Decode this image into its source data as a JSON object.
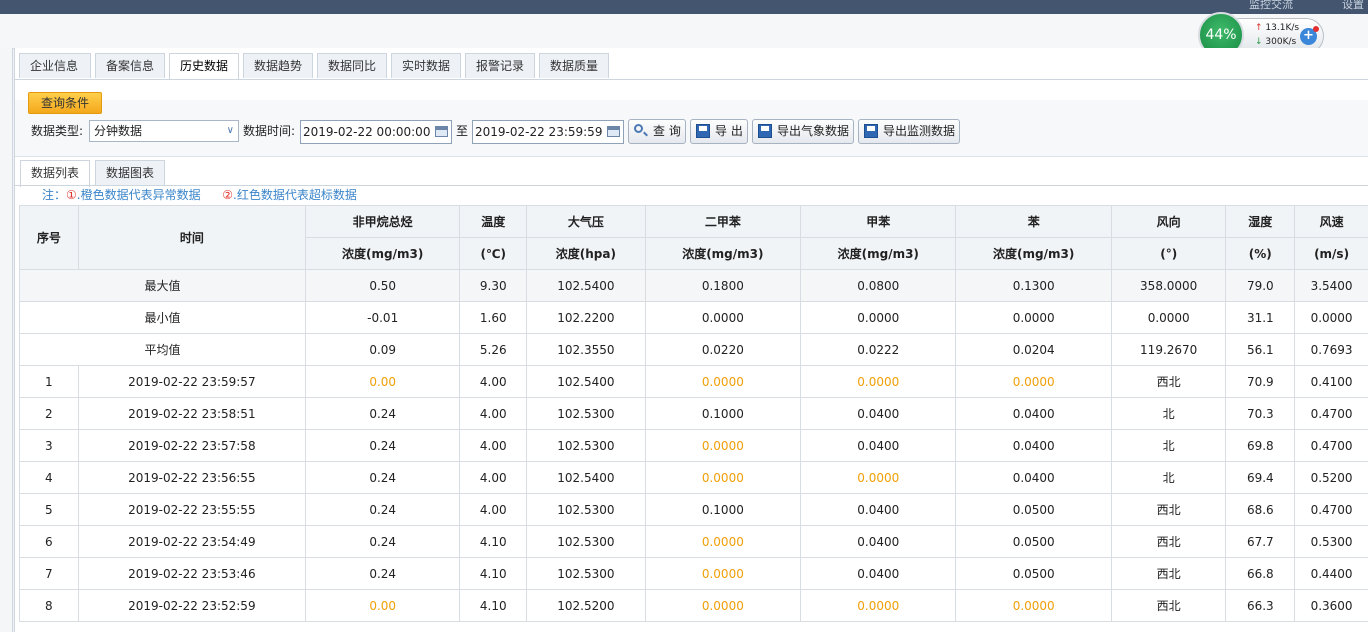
{
  "topbar": {
    "items": [
      "监控交流",
      "设置"
    ]
  },
  "tabs": [
    "企业信息",
    "备案信息",
    "历史数据",
    "数据趋势",
    "数据同比",
    "实时数据",
    "报警记录",
    "数据质量"
  ],
  "active_tab": 2,
  "query": {
    "header": "查询条件",
    "type_label": "数据类型:",
    "type_value": "分钟数据",
    "time_label": "数据时间:",
    "start": "2019-02-22 00:00:00",
    "to": "至",
    "end": "2019-02-22 23:59:59",
    "buttons": [
      "查 询",
      "导 出",
      "导出气象数据",
      "导出监测数据"
    ]
  },
  "subtabs": [
    "数据列表",
    "数据图表"
  ],
  "note": {
    "prefix": "注：",
    "n1": "①",
    "t1": ".橙色数据代表异常数据",
    "n2": "②",
    "t2": ".红色数据代表超标数据"
  },
  "table": {
    "col_seq": "序号",
    "col_time": "时间",
    "groups": [
      "非甲烷总烃",
      "温度",
      "大气压",
      "二甲苯",
      "甲苯",
      "苯",
      "风向",
      "湿度",
      "风速"
    ],
    "units": [
      "浓度(mg/m3)",
      "(℃)",
      "浓度(hpa)",
      "浓度(mg/m3)",
      "浓度(mg/m3)",
      "浓度(mg/m3)",
      "(°)",
      "(%)",
      "(m/s)"
    ],
    "stats": [
      {
        "label": "最大值",
        "v": [
          "0.50",
          "9.30",
          "102.5400",
          "0.1800",
          "0.0800",
          "0.1300",
          "358.0000",
          "79.0",
          "3.5400"
        ]
      },
      {
        "label": "最小值",
        "v": [
          "-0.01",
          "1.60",
          "102.2200",
          "0.0000",
          "0.0000",
          "0.0000",
          "0.0000",
          "31.1",
          "0.0000"
        ]
      },
      {
        "label": "平均值",
        "v": [
          "0.09",
          "5.26",
          "102.3550",
          "0.0220",
          "0.0222",
          "0.0204",
          "119.2670",
          "56.1",
          "0.7693"
        ]
      }
    ],
    "rows": [
      {
        "seq": "1",
        "time": "2019-02-22 23:59:57",
        "v": [
          "0.00",
          "4.00",
          "102.5400",
          "0.0000",
          "0.0000",
          "0.0000",
          "西北",
          "70.9",
          "0.4100"
        ],
        "orange": [
          0,
          3,
          4,
          5
        ]
      },
      {
        "seq": "2",
        "time": "2019-02-22 23:58:51",
        "v": [
          "0.24",
          "4.00",
          "102.5300",
          "0.1000",
          "0.0400",
          "0.0400",
          "北",
          "70.3",
          "0.4700"
        ],
        "orange": []
      },
      {
        "seq": "3",
        "time": "2019-02-22 23:57:58",
        "v": [
          "0.24",
          "4.00",
          "102.5300",
          "0.0000",
          "0.0400",
          "0.0400",
          "北",
          "69.8",
          "0.4700"
        ],
        "orange": [
          3
        ]
      },
      {
        "seq": "4",
        "time": "2019-02-22 23:56:55",
        "v": [
          "0.24",
          "4.00",
          "102.5400",
          "0.0000",
          "0.0000",
          "0.0400",
          "北",
          "69.4",
          "0.5200"
        ],
        "orange": [
          3,
          4
        ]
      },
      {
        "seq": "5",
        "time": "2019-02-22 23:55:55",
        "v": [
          "0.24",
          "4.00",
          "102.5300",
          "0.1000",
          "0.0400",
          "0.0500",
          "西北",
          "68.6",
          "0.4700"
        ],
        "orange": []
      },
      {
        "seq": "6",
        "time": "2019-02-22 23:54:49",
        "v": [
          "0.24",
          "4.10",
          "102.5300",
          "0.0000",
          "0.0400",
          "0.0500",
          "西北",
          "67.7",
          "0.5300"
        ],
        "orange": [
          3
        ]
      },
      {
        "seq": "7",
        "time": "2019-02-22 23:53:46",
        "v": [
          "0.24",
          "4.10",
          "102.5300",
          "0.0000",
          "0.0400",
          "0.0500",
          "西北",
          "66.8",
          "0.4400"
        ],
        "orange": [
          3
        ]
      },
      {
        "seq": "8",
        "time": "2019-02-22 23:52:59",
        "v": [
          "0.00",
          "4.10",
          "102.5200",
          "0.0000",
          "0.0000",
          "0.0000",
          "西北",
          "66.3",
          "0.3600"
        ],
        "orange": [
          0,
          3,
          4,
          5
        ]
      }
    ]
  },
  "widget": {
    "percent": "44%",
    "up": "13.1K/s",
    "down": "300K/s"
  },
  "colors": {
    "orange": "#f0a008",
    "red": "#e0302a",
    "note_blue": "#3a84c9"
  }
}
